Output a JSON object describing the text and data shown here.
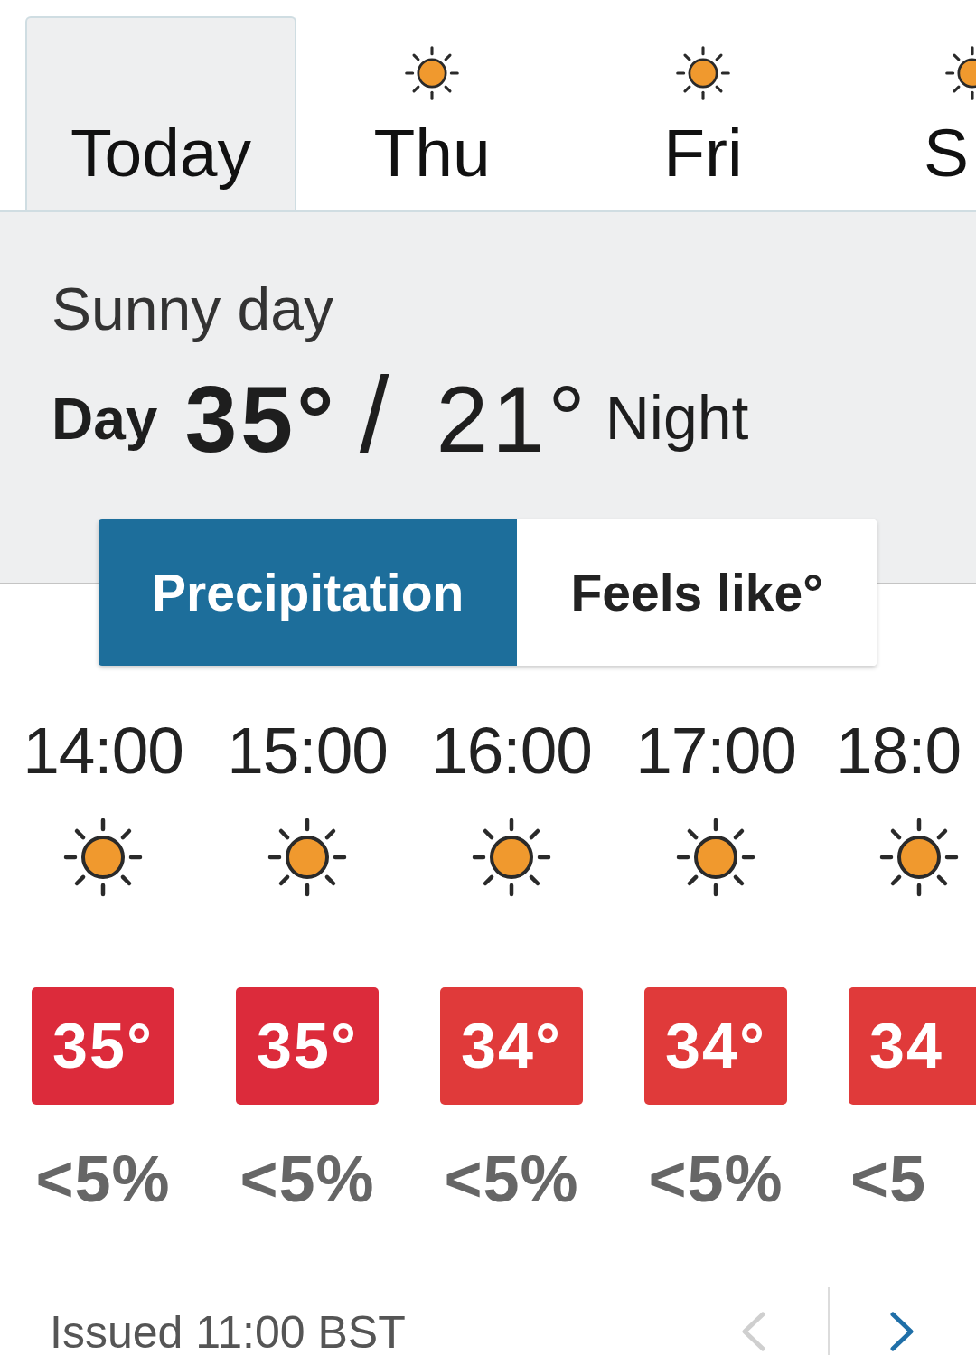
{
  "day_tabs": [
    {
      "label": "Today",
      "selected": true
    },
    {
      "label": "Thu",
      "selected": false
    },
    {
      "label": "Fri",
      "selected": false
    },
    {
      "label": "S",
      "selected": false
    }
  ],
  "summary": {
    "description": "Sunny day",
    "day_label": "Day",
    "day_temp": "35°",
    "separator": "/",
    "night_temp": "21°",
    "night_label": "Night"
  },
  "view_toggle": [
    {
      "label": "Precipitation",
      "selected": true
    },
    {
      "label": "Feels like°",
      "selected": false
    }
  ],
  "hours": [
    {
      "time": "14:00",
      "temp": "35°",
      "color": "#dc2b3b",
      "precip": "<5%"
    },
    {
      "time": "15:00",
      "temp": "35°",
      "color": "#dc2b3b",
      "precip": "<5%"
    },
    {
      "time": "16:00",
      "temp": "34°",
      "color": "#e03a3a",
      "precip": "<5%"
    },
    {
      "time": "17:00",
      "temp": "34°",
      "color": "#e03a3a",
      "precip": "<5%"
    },
    {
      "time": "18:0",
      "temp": "34",
      "color": "#e03a3a",
      "precip": "<5"
    }
  ],
  "footer": {
    "issued": "Issued 11:00 BST",
    "nav": [
      {
        "kind": "previous",
        "disabled": true
      },
      {
        "kind": "next",
        "disabled": false
      }
    ]
  }
}
